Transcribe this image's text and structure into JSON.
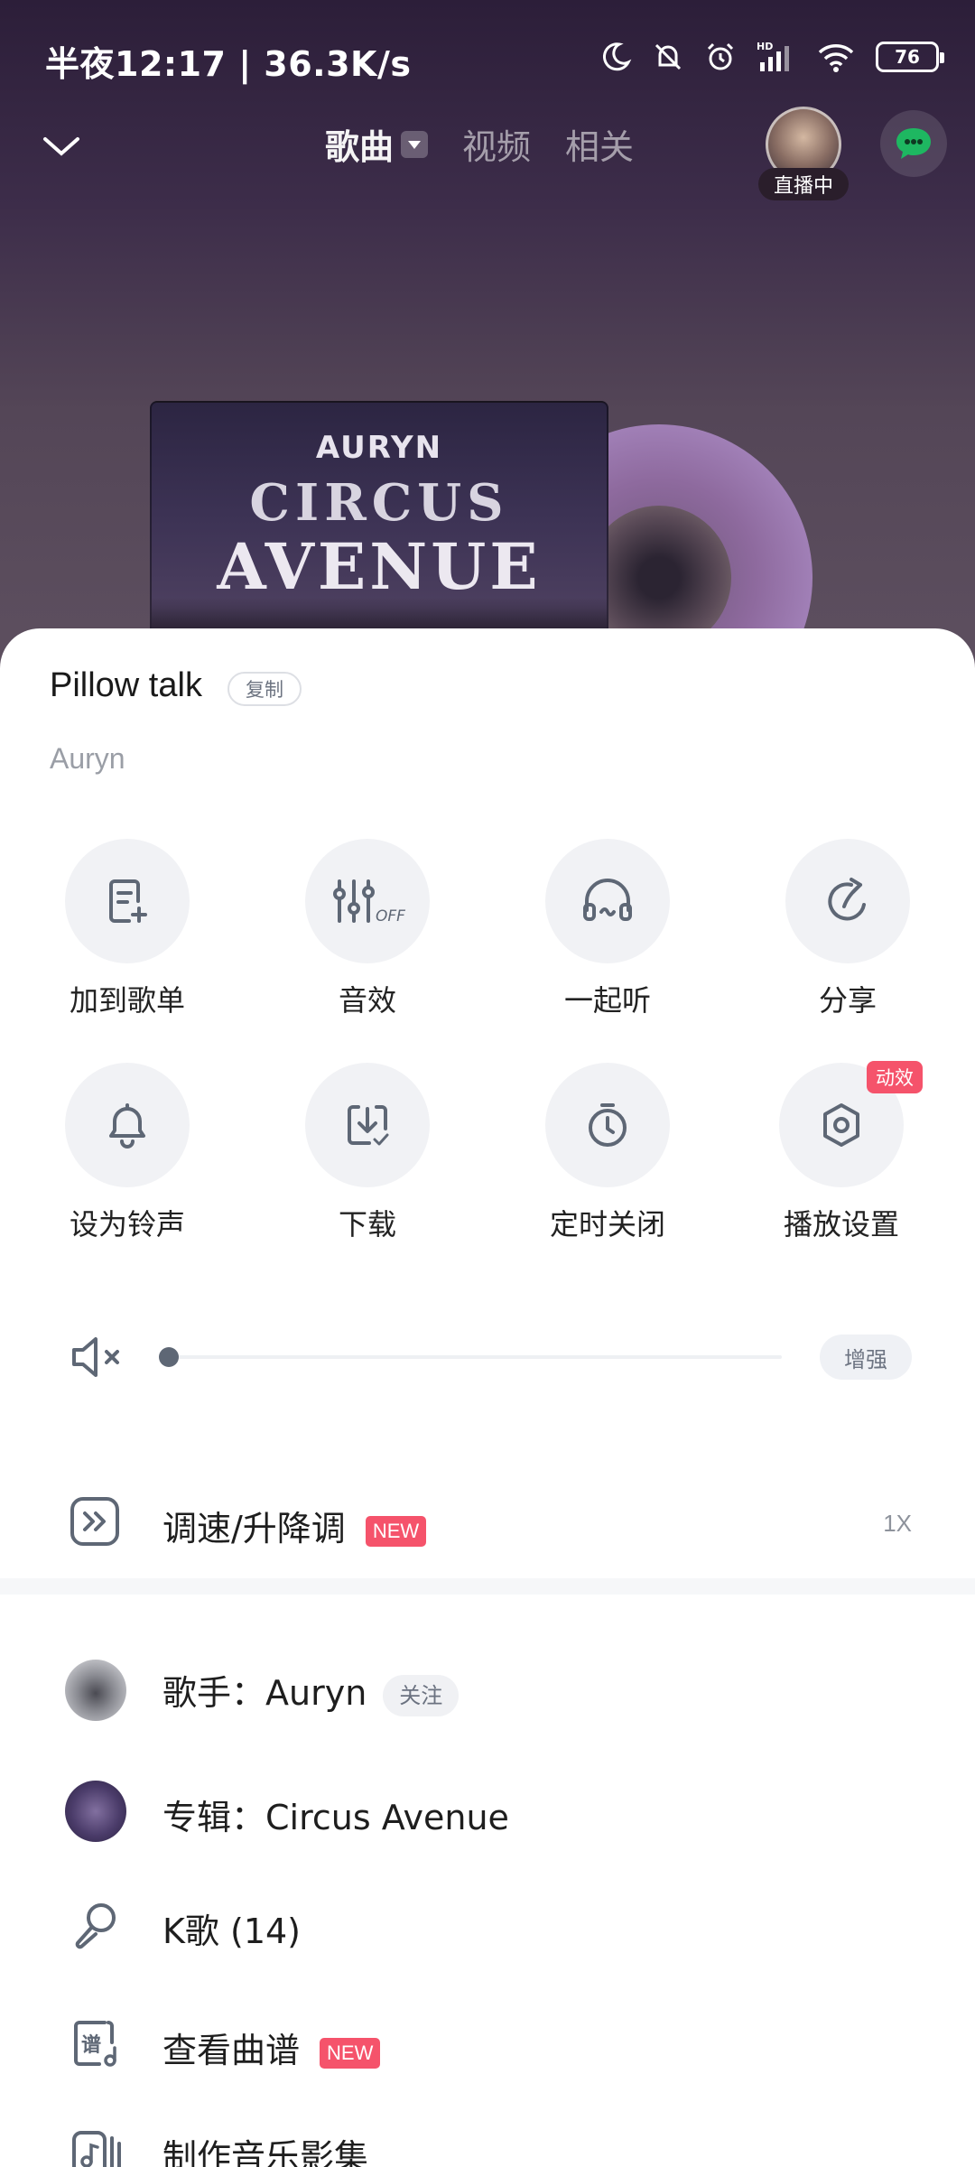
{
  "status_bar": {
    "time": "半夜12:17 | 36.3K/s",
    "battery": "76"
  },
  "nav": {
    "tabs": [
      "歌曲",
      "视频",
      "相关"
    ],
    "live_badge": "直播中"
  },
  "cover": {
    "band": "AURYN",
    "title_line1": "CIRCUS",
    "title_line2": "AVENUE"
  },
  "song": {
    "title": "Pillow talk",
    "copy_label": "复制",
    "artist": "Auryn"
  },
  "actions": [
    {
      "label": "加到歌单",
      "icon": "add-to-playlist-icon"
    },
    {
      "label": "音效",
      "icon": "equalizer-off-icon"
    },
    {
      "label": "一起听",
      "icon": "listen-together-icon"
    },
    {
      "label": "分享",
      "icon": "share-icon"
    },
    {
      "label": "设为铃声",
      "icon": "bell-icon"
    },
    {
      "label": "下载",
      "icon": "download-icon"
    },
    {
      "label": "定时关闭",
      "icon": "timer-icon"
    },
    {
      "label": "播放设置",
      "icon": "settings-icon",
      "badge": "动效"
    }
  ],
  "volume": {
    "level": 0,
    "boost_label": "增强"
  },
  "speed": {
    "label": "调速/升降调",
    "new_badge": "NEW",
    "value": "1X"
  },
  "list": {
    "singer": {
      "label": "歌手：Auryn",
      "follow_label": "关注"
    },
    "album": {
      "label": "专辑：Circus Avenue"
    },
    "karaoke": {
      "label": "K歌 (14)"
    },
    "score": {
      "label": "查看曲谱",
      "new_badge": "NEW"
    },
    "movie": {
      "label": "制作音乐影集"
    }
  },
  "colors": {
    "accent_red": "#f5536b",
    "icon_gray": "#5e6775",
    "circle_bg": "#f1f2f5"
  }
}
